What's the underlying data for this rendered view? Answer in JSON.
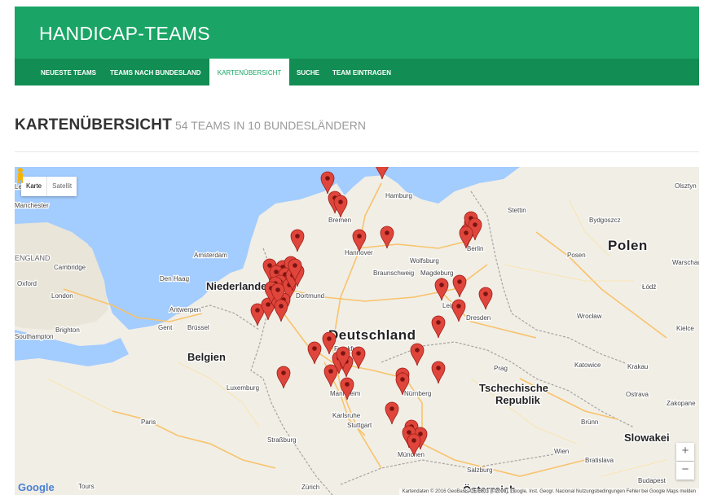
{
  "site": {
    "title": "HANDICAP-TEAMS"
  },
  "nav": [
    {
      "label": "NEUESTE TEAMS",
      "active": false
    },
    {
      "label": "TEAMS NACH BUNDESLAND",
      "active": false
    },
    {
      "label": "KARTENÜBERSICHT",
      "active": true
    },
    {
      "label": "SUCHE",
      "active": false
    },
    {
      "label": "TEAM EINTRAGEN",
      "active": false
    }
  ],
  "page": {
    "title": "KARTENÜBERSICHT",
    "subtitle": "54 TEAMS IN 10 BUNDESLÄNDERN"
  },
  "map": {
    "maptype": {
      "map": "Karte",
      "satellite": "Satellit"
    },
    "zoom_in": "+",
    "zoom_out": "−",
    "logo": "Google",
    "attribution": "Kartendaten © 2016 GeoBasis-DE/BKG (©2009), Google, Inst. Geogr. Nacional   Nutzungsbedingungen   Fehler bei Google Maps melden",
    "labels": [
      {
        "text": "Hamburg",
        "cls": "city"
      },
      {
        "text": "Bremen",
        "cls": "city"
      },
      {
        "text": "Stettin",
        "cls": "city"
      },
      {
        "text": "Bydgoszcz",
        "cls": "city"
      },
      {
        "text": "Olsztyn",
        "cls": "city"
      },
      {
        "text": "Polen",
        "cls": "country"
      },
      {
        "text": "Amsterdam",
        "cls": "city"
      },
      {
        "text": "Den Haag",
        "cls": "city"
      },
      {
        "text": "Niederlande",
        "cls": "country-md"
      },
      {
        "text": "Hannover",
        "cls": "city"
      },
      {
        "text": "Wolfsburg",
        "cls": "city"
      },
      {
        "text": "Braunschweig",
        "cls": "city"
      },
      {
        "text": "Magdeburg",
        "cls": "city"
      },
      {
        "text": "Berlin",
        "cls": "city"
      },
      {
        "text": "Posen",
        "cls": "city"
      },
      {
        "text": "Warschau",
        "cls": "city"
      },
      {
        "text": "Łódź",
        "cls": "city"
      },
      {
        "text": "Dortmund",
        "cls": "city"
      },
      {
        "text": "Leipzig",
        "cls": "city"
      },
      {
        "text": "Dresden",
        "cls": "city"
      },
      {
        "text": "Wrocław",
        "cls": "city"
      },
      {
        "text": "Kielce",
        "cls": "city"
      },
      {
        "text": "Antwerpen",
        "cls": "city"
      },
      {
        "text": "Gent",
        "cls": "city"
      },
      {
        "text": "Brüssel",
        "cls": "city"
      },
      {
        "text": "Belgien",
        "cls": "country-md"
      },
      {
        "text": "Deutschland",
        "cls": "country"
      },
      {
        "text": "Frankfurt",
        "cls": "city"
      },
      {
        "text": "Prag",
        "cls": "city"
      },
      {
        "text": "Katowice",
        "cls": "city"
      },
      {
        "text": "Krakau",
        "cls": "city"
      },
      {
        "text": "Luxemburg",
        "cls": "city"
      },
      {
        "text": "Mannheim",
        "cls": "city"
      },
      {
        "text": "Nürnberg",
        "cls": "city"
      },
      {
        "text": "Tschechische",
        "cls": "country-md"
      },
      {
        "text": "Republik",
        "cls": "country-md"
      },
      {
        "text": "Ostrava",
        "cls": "city"
      },
      {
        "text": "Karlsruhe",
        "cls": "city"
      },
      {
        "text": "Stuttgart",
        "cls": "city"
      },
      {
        "text": "Paris",
        "cls": "city"
      },
      {
        "text": "Straßburg",
        "cls": "city"
      },
      {
        "text": "Brünn",
        "cls": "city"
      },
      {
        "text": "Slowakei",
        "cls": "country-md"
      },
      {
        "text": "Wien",
        "cls": "city"
      },
      {
        "text": "Bratislava",
        "cls": "city"
      },
      {
        "text": "Zakopane",
        "cls": "city"
      },
      {
        "text": "München",
        "cls": "city"
      },
      {
        "text": "Salzburg",
        "cls": "city"
      },
      {
        "text": "Österreich",
        "cls": "country-md"
      },
      {
        "text": "Budapest",
        "cls": "city"
      },
      {
        "text": "Zürich",
        "cls": "city"
      },
      {
        "text": "Tours",
        "cls": "city"
      },
      {
        "text": "London",
        "cls": "city"
      },
      {
        "text": "Oxford",
        "cls": "city"
      },
      {
        "text": "Cambridge",
        "cls": "city"
      },
      {
        "text": "Brighton",
        "cls": "city"
      },
      {
        "text": "Southampton",
        "cls": "city"
      },
      {
        "text": "Manchester",
        "cls": "city"
      },
      {
        "text": "ENGLAND",
        "cls": "region"
      },
      {
        "text": "Le",
        "cls": "city"
      }
    ],
    "markers_count": 54
  },
  "colors": {
    "header": "#1aa566",
    "nav": "#128d53",
    "water": "#a3ccff",
    "land": "#f1eee6",
    "marker": "#e0453b"
  }
}
